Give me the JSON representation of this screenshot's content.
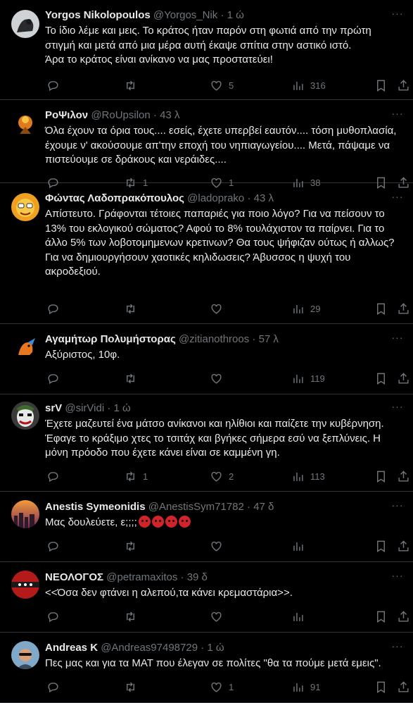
{
  "tweets": [
    {
      "name": "Yorgos Nikolopoulos",
      "handle": "@Yorgos_Nik",
      "time": "1 ώ",
      "text": "Το ίδιο λέμε και μεις. Το κράτος ήταν παρόν στη φωτιά από την πρώτη\nστιγμή και μετά από μια μέρα αυτή έκαψε σπίτια στην αστικό ιστό.\nΆρα το κράτος είναι ανίκανο να μας προστατεύει!",
      "replies": "",
      "retweets": "",
      "likes": "5",
      "views": "316"
    },
    {
      "name": "ΡοΨιλον",
      "handle": "@RoUpsilon",
      "time": "43 λ",
      "text": "Όλα έχουν τα όρια τους.... εσείς, έχετε υπερβεί εαυτόν.... τόση μυθοπλασία,\nέχουμε ν' ακούσουμε απ'την εποχή του νηπιαγωγείου.... Μετά, πάψαμε να\nπιστεύουμε σε δράκους και νεράιδες....",
      "replies": "",
      "retweets": "1",
      "likes": "1",
      "views": "38"
    },
    {
      "name": "Φώντας Λαδοπρακόπουλος",
      "handle": "@ladoprako",
      "time": "43 λ",
      "text": "Απίστευτο. Γράφονται τέτοιες παπαριές για ποιο λόγο? Για να πείσουν το\n13% του εκλογικού σώματος? Αφού το 8% τουλάχιστον τα παίρνει. Για το\nάλλο 5% των λοβοτομημενων κρετινων? Θα τους ψήφιζαν ούτως ή αλλως?\nΓια να δημιουργήσουν χαοτικές κηλιδωσεις? Άβυσσος η ψυχή του\nακροδεξιού.",
      "replies": "",
      "retweets": "",
      "likes": "",
      "views": "29"
    },
    {
      "name": "Αγαμήτωρ Πολυμήστορας",
      "handle": "@zitianothroos",
      "time": "57 λ",
      "text": "Αξύριστος, 10φ.",
      "replies": "",
      "retweets": "",
      "likes": "",
      "views": "119"
    },
    {
      "name": "srV",
      "handle": "@sirVidi",
      "time": "1 ώ",
      "text": "Έχετε μαζευτεί ένα μάτσο ανίκανοι και ηλίθιοι και παίζετε την κυβέρνηση.\nΈφαγε το κράξιμο χτες το τσιτάχ και βγήκες σήμερα εσύ να ξεπλύνεις. Η\nμόνη πρόοδο που έχετε κάνει είναι σε καμμένη γη.",
      "replies": "",
      "retweets": "1",
      "likes": "2",
      "views": "113"
    },
    {
      "name": "Anestis Symeonidis",
      "handle": "@AnestisSym71782",
      "time": "47 δ",
      "text": "Μας δουλεύετε, ε;;;;",
      "replies": "",
      "retweets": "",
      "likes": "",
      "views": ""
    },
    {
      "name": "ΝΕΟΛΟΓΟΣ",
      "handle": "@petramaxitos",
      "time": "39 δ",
      "text": "<<Όσα δεν φτάνει η αλεπού,τα κάνει κρεμαστάρια>>.",
      "replies": "",
      "retweets": "",
      "likes": "",
      "views": ""
    },
    {
      "name": "Andreas K",
      "handle": "@Andreas97498729",
      "time": "1 ώ",
      "text": "Πες μας και για τα ΜΑΤ που έλεγαν σε πολίτες \"θα τα πούμε μετά εμεις\".",
      "replies": "",
      "retweets": "",
      "likes": "1",
      "views": "91"
    }
  ],
  "separator": "·",
  "more_glyph": "···",
  "colors": {
    "background": "#000000",
    "text": "#e7e9ea",
    "muted": "#71767b",
    "divider": "#2f3336"
  },
  "icons": [
    "reply-icon",
    "retweet-icon",
    "like-icon",
    "views-icon",
    "bookmark-icon",
    "share-icon"
  ]
}
